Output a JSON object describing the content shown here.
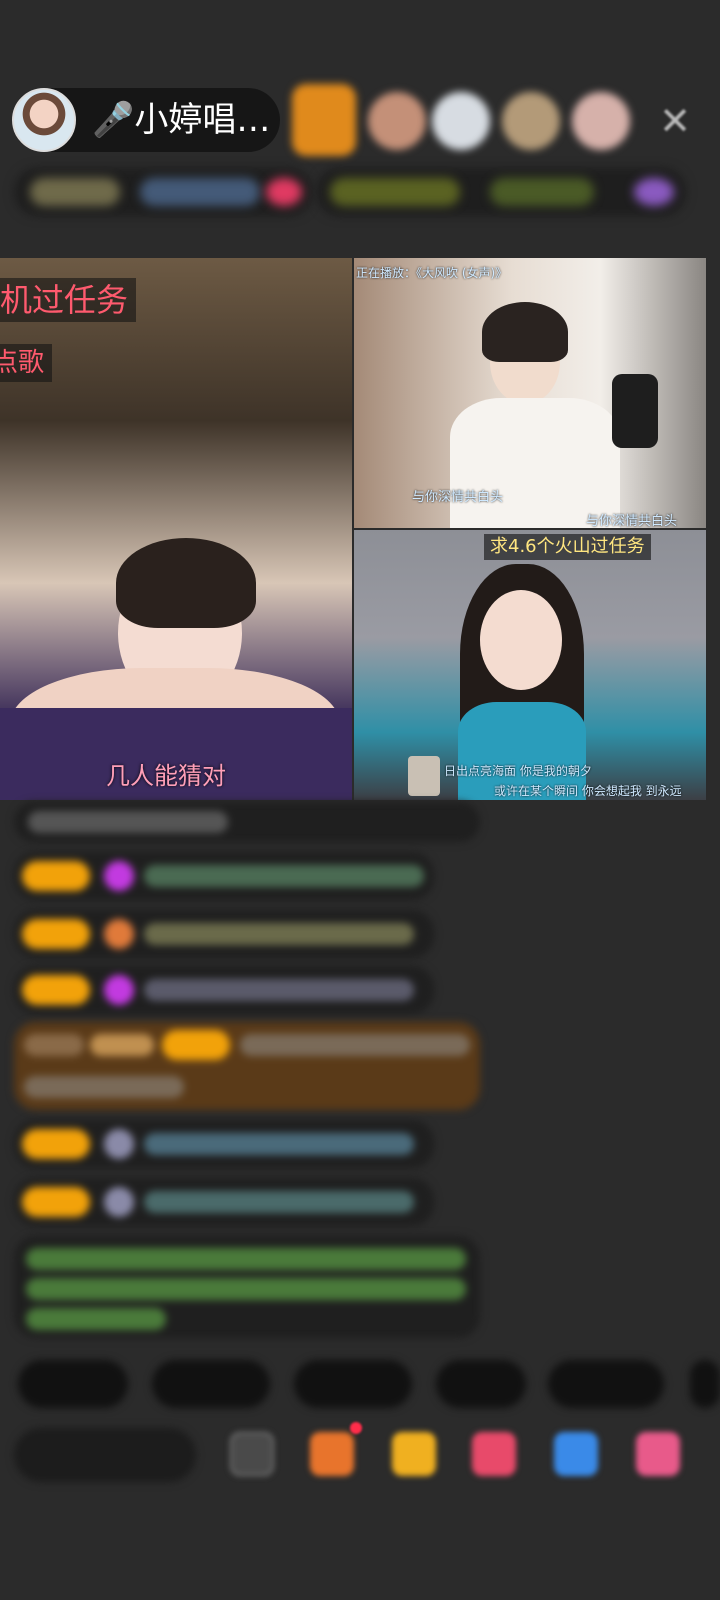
{
  "header": {
    "host_name": "🎤小婷唱…",
    "close_symbol": "✕"
  },
  "video_overlays": {
    "main_task": "机过任务",
    "main_song": "点歌",
    "main_caption": "几人能猜对",
    "top_right_header": "正在播放：《大风吹 (女声)》",
    "top_right_caption_1": "与你深情共白头",
    "top_right_caption_2": "与你深情共白头",
    "bottom_right_task": "求4.6个火山过任务",
    "bottom_right_lyrics_1": "日出点亮海面  你是我的朝夕",
    "bottom_right_lyrics_2": "或许在某个瞬间  你会想起我  到永远"
  }
}
